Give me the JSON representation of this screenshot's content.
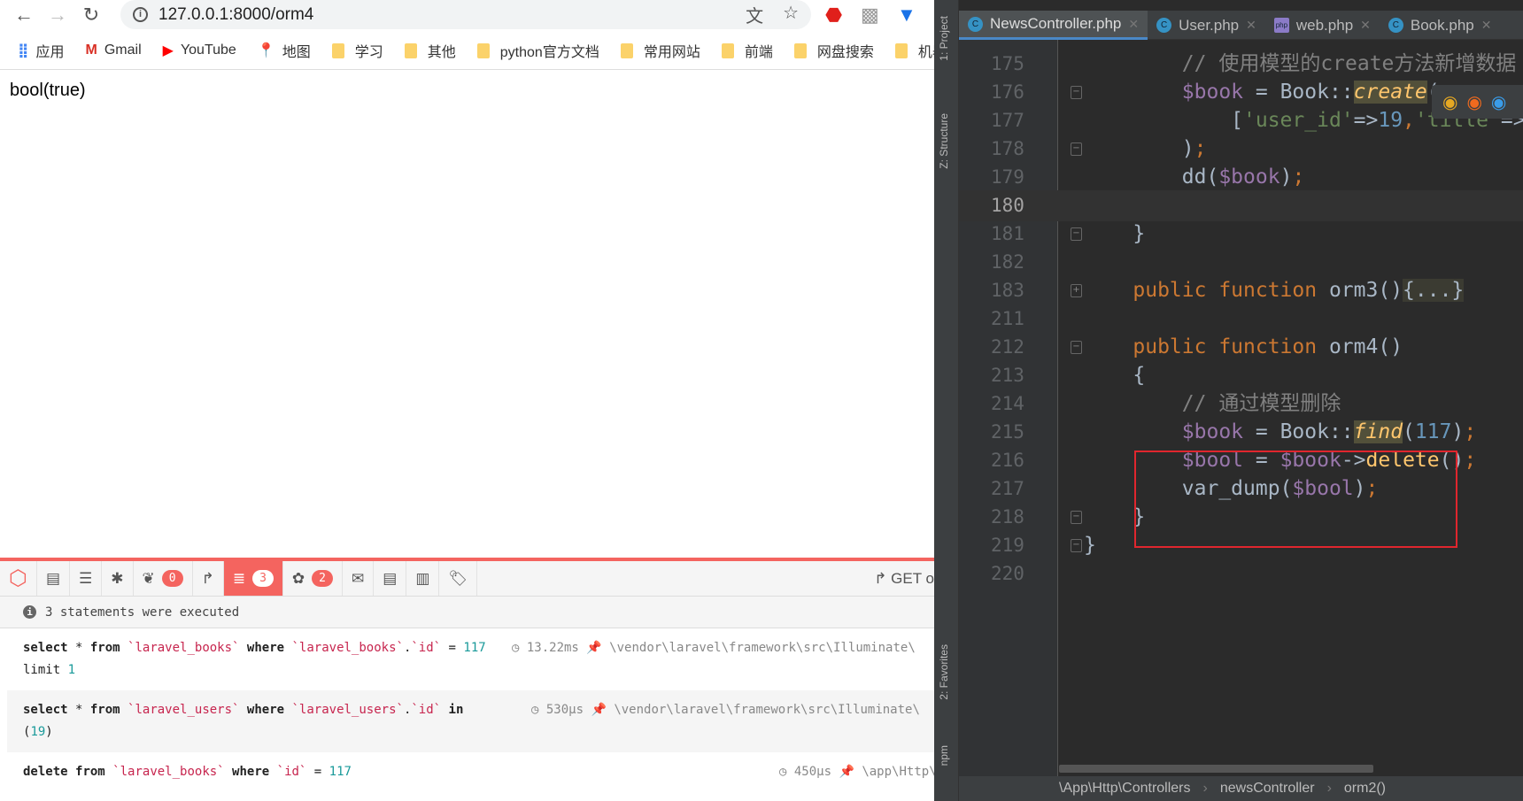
{
  "browser": {
    "url": "127.0.0.1:8000/orm4",
    "bookmarks": [
      {
        "label": "应用",
        "icon": "apps-icon"
      },
      {
        "label": "Gmail",
        "icon": "gmail-icon"
      },
      {
        "label": "YouTube",
        "icon": "youtube-icon"
      },
      {
        "label": "地图",
        "icon": "maps-icon"
      },
      {
        "label": "学习",
        "icon": "folder-icon"
      },
      {
        "label": "其他",
        "icon": "folder-icon"
      },
      {
        "label": "python官方文档",
        "icon": "folder-icon"
      },
      {
        "label": "常用网站",
        "icon": "folder-icon"
      },
      {
        "label": "前端",
        "icon": "folder-icon"
      },
      {
        "label": "网盘搜索",
        "icon": "folder-icon"
      },
      {
        "label": "机器",
        "icon": "folder-icon"
      }
    ],
    "page_output": "bool(true)"
  },
  "debugbar": {
    "accent": "#f4645f",
    "tabs": [
      {
        "icon": "laravel-logo-icon"
      },
      {
        "icon": "messages-icon"
      },
      {
        "icon": "timeline-icon"
      },
      {
        "icon": "exceptions-bug-icon"
      },
      {
        "icon": "views-leaf-icon",
        "badge": "0"
      },
      {
        "icon": "route-icon"
      },
      {
        "icon": "database-icon",
        "badge": "3",
        "active": true
      },
      {
        "icon": "models-icon",
        "badge": "2"
      },
      {
        "icon": "mail-icon"
      },
      {
        "icon": "request-icon"
      },
      {
        "icon": "session-icon"
      },
      {
        "icon": "tags-icon"
      }
    ],
    "method": "GET o",
    "summary": "3 statements were executed",
    "statements": [
      {
        "parts": [
          [
            "kw",
            "select"
          ],
          [
            "p",
            " * "
          ],
          [
            "kw",
            "from"
          ],
          [
            "p",
            " "
          ],
          [
            "id",
            "`laravel_books`"
          ],
          [
            "p",
            " "
          ],
          [
            "kw",
            "where"
          ],
          [
            "p",
            " "
          ],
          [
            "id",
            "`laravel_books`"
          ],
          [
            "p",
            "."
          ],
          [
            "id",
            "`id`"
          ],
          [
            "p",
            " = "
          ],
          [
            "n",
            "117"
          ],
          [
            "p",
            " limit "
          ],
          [
            "n",
            "1"
          ]
        ],
        "duration": "13.22ms",
        "source": "\\vendor\\laravel\\framework\\src\\Illuminate\\"
      },
      {
        "parts": [
          [
            "kw",
            "select"
          ],
          [
            "p",
            " * "
          ],
          [
            "kw",
            "from"
          ],
          [
            "p",
            " "
          ],
          [
            "id",
            "`laravel_users`"
          ],
          [
            "p",
            " "
          ],
          [
            "kw",
            "where"
          ],
          [
            "p",
            " "
          ],
          [
            "id",
            "`laravel_users`"
          ],
          [
            "p",
            "."
          ],
          [
            "id",
            "`id`"
          ],
          [
            "p",
            " "
          ],
          [
            "kw",
            "in"
          ],
          [
            "p",
            " ("
          ],
          [
            "n",
            "19"
          ],
          [
            "p",
            ")"
          ]
        ],
        "duration": "530μs",
        "source": "\\vendor\\laravel\\framework\\src\\Illuminate\\"
      },
      {
        "parts": [
          [
            "kw",
            "delete"
          ],
          [
            "p",
            " "
          ],
          [
            "kw",
            "from"
          ],
          [
            "p",
            " "
          ],
          [
            "id",
            "`laravel_books`"
          ],
          [
            "p",
            " "
          ],
          [
            "kw",
            "where"
          ],
          [
            "p",
            " "
          ],
          [
            "id",
            "`id`"
          ],
          [
            "p",
            " = "
          ],
          [
            "n",
            "117"
          ]
        ],
        "duration": "450μs",
        "source": "\\app\\Http\\"
      }
    ]
  },
  "ide": {
    "side_labels": {
      "project": "1: Project",
      "structure": "Z: Structure",
      "favorites": "2: Favorites",
      "npm": "npm"
    },
    "tabs": [
      {
        "label": "NewsController.php",
        "icon": "php-class-icon",
        "active": true
      },
      {
        "label": "User.php",
        "icon": "php-class-icon"
      },
      {
        "label": "web.php",
        "icon": "php-file-icon"
      },
      {
        "label": "Book.php",
        "icon": "php-class-icon"
      }
    ],
    "current_line": "180",
    "lines": [
      {
        "n": "175",
        "fold": "",
        "tokens": [
          [
            "p",
            "        "
          ],
          [
            "cm",
            "// 使用模型的create方法新增数据"
          ]
        ]
      },
      {
        "n": "176",
        "fold": "-",
        "tokens": [
          [
            "p",
            "        "
          ],
          [
            "var",
            "$book"
          ],
          [
            "p",
            " = Book::"
          ],
          [
            "fni",
            "create"
          ],
          [
            "p",
            "("
          ]
        ]
      },
      {
        "n": "177",
        "fold": "",
        "tokens": [
          [
            "p",
            "            ["
          ],
          [
            "str",
            "'user_id'"
          ],
          [
            "p",
            "=>"
          ],
          [
            "num",
            "19"
          ],
          [
            "kw",
            ","
          ],
          [
            "str",
            "'title'"
          ],
          [
            "p",
            "=>"
          ],
          [
            "str",
            "'"
          ]
        ]
      },
      {
        "n": "178",
        "fold": "-",
        "tokens": [
          [
            "p",
            "        )"
          ],
          [
            "kw",
            ";"
          ]
        ]
      },
      {
        "n": "179",
        "fold": "",
        "tokens": [
          [
            "p",
            "        dd("
          ],
          [
            "var",
            "$book"
          ],
          [
            "p",
            ")"
          ],
          [
            "kw",
            ";"
          ]
        ]
      },
      {
        "n": "180",
        "fold": "",
        "tokens": []
      },
      {
        "n": "181",
        "fold": "-",
        "tokens": [
          [
            "p",
            "    }"
          ]
        ]
      },
      {
        "n": "182",
        "fold": "",
        "tokens": []
      },
      {
        "n": "183",
        "fold": "+",
        "tokens": [
          [
            "p",
            "    "
          ],
          [
            "kw",
            "public function "
          ],
          [
            "p",
            "orm3()"
          ],
          [
            "fold",
            "{...}"
          ]
        ]
      },
      {
        "n": "211",
        "fold": "",
        "tokens": []
      },
      {
        "n": "212",
        "fold": "-",
        "tokens": [
          [
            "p",
            "    "
          ],
          [
            "kw",
            "public function "
          ],
          [
            "p",
            "orm4()"
          ]
        ]
      },
      {
        "n": "213",
        "fold": "",
        "tokens": [
          [
            "p",
            "    {"
          ]
        ]
      },
      {
        "n": "214",
        "fold": "",
        "tokens": [
          [
            "p",
            "        "
          ],
          [
            "cm",
            "// 通过模型删除"
          ]
        ]
      },
      {
        "n": "215",
        "fold": "",
        "tokens": [
          [
            "p",
            "        "
          ],
          [
            "var",
            "$book"
          ],
          [
            "p",
            " = Book::"
          ],
          [
            "fni",
            "find"
          ],
          [
            "p",
            "("
          ],
          [
            "num",
            "117"
          ],
          [
            "p",
            ")"
          ],
          [
            "kw",
            ";"
          ]
        ]
      },
      {
        "n": "216",
        "fold": "",
        "tokens": [
          [
            "p",
            "        "
          ],
          [
            "var",
            "$bool"
          ],
          [
            "p",
            " = "
          ],
          [
            "var",
            "$book"
          ],
          [
            "p",
            "->"
          ],
          [
            "fn",
            "delete"
          ],
          [
            "p",
            "()"
          ],
          [
            "kw",
            ";"
          ]
        ]
      },
      {
        "n": "217",
        "fold": "",
        "tokens": [
          [
            "p",
            "        var_dump("
          ],
          [
            "var",
            "$bool"
          ],
          [
            "p",
            ")"
          ],
          [
            "kw",
            ";"
          ]
        ]
      },
      {
        "n": "218",
        "fold": "-",
        "tokens": [
          [
            "p",
            "    }"
          ]
        ]
      },
      {
        "n": "219",
        "fold": "-",
        "tokens": [
          [
            "p",
            "}"
          ]
        ]
      },
      {
        "n": "220",
        "fold": "",
        "tokens": []
      }
    ],
    "breadcrumbs": [
      "\\App\\Http\\Controllers",
      "newsController",
      "orm2()"
    ],
    "highlight_box_color": "#e0262e"
  }
}
